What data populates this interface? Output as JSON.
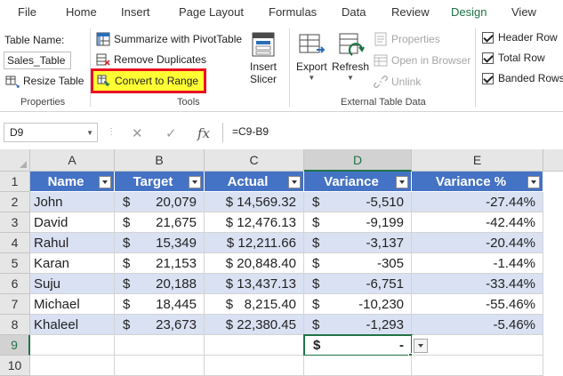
{
  "menu": {
    "tabs": [
      "File",
      "Home",
      "Insert",
      "Page Layout",
      "Formulas",
      "Data",
      "Review",
      "Design",
      "View"
    ],
    "active_index": 7
  },
  "ribbon": {
    "properties": {
      "table_name_label": "Table Name:",
      "table_name_value": "Sales_Table",
      "resize_label": "Resize Table",
      "group_label": "Properties"
    },
    "tools": {
      "pivot_label": "Summarize with PivotTable",
      "remove_dup_label": "Remove Duplicates",
      "convert_label": "Convert to Range",
      "insert_slicer_line1": "Insert",
      "insert_slicer_line2": "Slicer",
      "group_label": "Tools"
    },
    "external": {
      "export_label": "Export",
      "refresh_label": "Refresh",
      "properties_label": "Properties",
      "open_browser_label": "Open in Browser",
      "unlink_label": "Unlink",
      "group_label": "External Table Data"
    },
    "style_options": {
      "header_row_label": "Header Row",
      "total_row_label": "Total Row",
      "banded_rows_label": "Banded Rows"
    }
  },
  "formula_bar": {
    "name_box": "D9",
    "cancel_symbol": "✕",
    "enter_symbol": "✓",
    "fx_symbol": "fx",
    "formula": "=C9-B9"
  },
  "grid": {
    "columns": [
      "A",
      "B",
      "C",
      "D",
      "E"
    ],
    "rows": [
      "1",
      "2",
      "3",
      "4",
      "5",
      "6",
      "7",
      "8",
      "9",
      "10"
    ],
    "selected_column": "D",
    "selected_row": "9",
    "table_headers": [
      "Name",
      "Target",
      "Actual",
      "Variance",
      "Variance %"
    ],
    "table_rows": [
      {
        "name": "John",
        "target_cur": "$",
        "target": "20,079",
        "actual": "$ 14,569.32",
        "variance_cur": "$",
        "variance": "-5,510",
        "variance_pct": "-27.44%"
      },
      {
        "name": "David",
        "target_cur": "$",
        "target": "21,675",
        "actual": "$ 12,476.13",
        "variance_cur": "$",
        "variance": "-9,199",
        "variance_pct": "-42.44%"
      },
      {
        "name": "Rahul",
        "target_cur": "$",
        "target": "15,349",
        "actual": "$ 12,211.66",
        "variance_cur": "$",
        "variance": "-3,137",
        "variance_pct": "-20.44%"
      },
      {
        "name": "Karan",
        "target_cur": "$",
        "target": "21,153",
        "actual": "$ 20,848.40",
        "variance_cur": "$",
        "variance": "-305",
        "variance_pct": "-1.44%"
      },
      {
        "name": "Suju",
        "target_cur": "$",
        "target": "20,188",
        "actual": "$ 13,437.13",
        "variance_cur": "$",
        "variance": "-6,751",
        "variance_pct": "-33.44%"
      },
      {
        "name": "Michael",
        "target_cur": "$",
        "target": "18,445",
        "actual": "$   8,215.40",
        "variance_cur": "$",
        "variance": "-10,230",
        "variance_pct": "-55.46%"
      },
      {
        "name": "Khaleel",
        "target_cur": "$",
        "target": "23,673",
        "actual": "$ 22,380.45",
        "variance_cur": "$",
        "variance": "-1,293",
        "variance_pct": "-5.46%"
      }
    ],
    "total_row": {
      "variance_cur": "$",
      "variance": "-"
    }
  },
  "colors": {
    "header_fill": "#4472c4",
    "band_fill": "#d9e1f2",
    "selection": "#217346",
    "highlight_fill": "#ffff33",
    "highlight_border": "#e81123"
  }
}
